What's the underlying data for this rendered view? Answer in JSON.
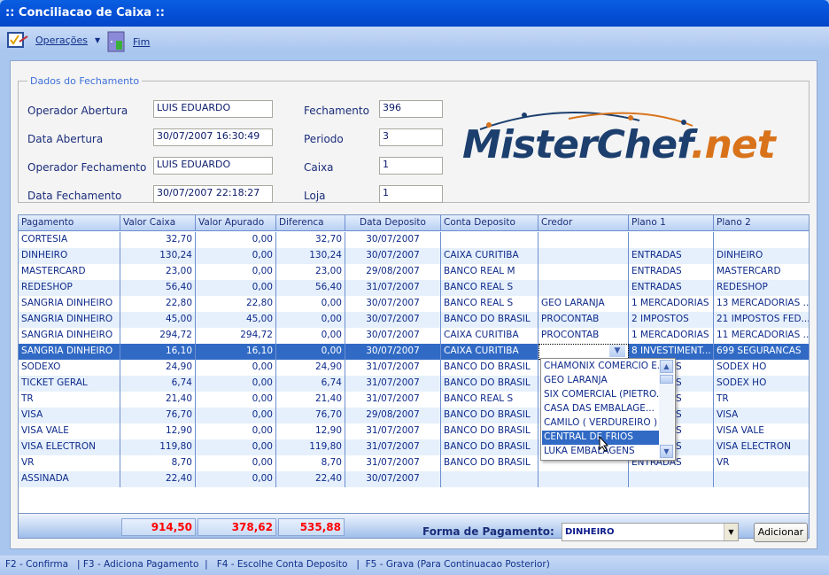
{
  "window": {
    "title": ":: Conciliacao de Caixa ::"
  },
  "toolbar": {
    "operacoes": "Operações",
    "fim": "Fim"
  },
  "fieldset": {
    "legend": "Dados do Fechamento",
    "operador_abertura_label": "Operador Abertura",
    "operador_abertura": "LUIS EDUARDO",
    "data_abertura_label": "Data Abertura",
    "data_abertura": "30/07/2007 16:30:49",
    "operador_fechamento_label": "Operador Fechamento",
    "operador_fechamento": "LUIS EDUARDO",
    "data_fechamento_label": "Data Fechamento",
    "data_fechamento": "30/07/2007 22:18:27",
    "fechamento_label": "Fechamento",
    "fechamento": "396",
    "periodo_label": "Periodo",
    "periodo": "3",
    "caixa_label": "Caixa",
    "caixa": "1",
    "loja_label": "Loja",
    "loja": "1"
  },
  "logo": {
    "text": "MisterChef",
    "suffix": ".net"
  },
  "grid": {
    "columns": [
      "Pagamento",
      "Valor Caixa",
      "Valor Apurado",
      "Diferenca",
      "Data Deposito",
      "Conta Deposito",
      "Credor",
      "Plano 1",
      "Plano 2"
    ],
    "rows": [
      [
        "CORTESIA",
        "32,70",
        "0,00",
        "32,70",
        "30/07/2007",
        "",
        "",
        "",
        ""
      ],
      [
        "DINHEIRO",
        "130,24",
        "0,00",
        "130,24",
        "30/07/2007",
        "CAIXA CURITIBA",
        "",
        "ENTRADAS",
        "DINHEIRO"
      ],
      [
        "MASTERCARD",
        "23,00",
        "0,00",
        "23,00",
        "29/08/2007",
        "BANCO REAL M",
        "",
        "ENTRADAS",
        "MASTERCARD"
      ],
      [
        "REDESHOP",
        "56,40",
        "0,00",
        "56,40",
        "31/07/2007",
        "BANCO REAL S",
        "",
        "ENTRADAS",
        "REDESHOP"
      ],
      [
        "SANGRIA DINHEIRO",
        "22,80",
        "22,80",
        "0,00",
        "30/07/2007",
        "BANCO REAL S",
        "GEO LARANJA",
        "1 MERCADORIAS",
        "13 MERCADORIAS ..."
      ],
      [
        "SANGRIA DINHEIRO",
        "45,00",
        "45,00",
        "0,00",
        "30/07/2007",
        "BANCO DO BRASIL",
        "PROCONTAB",
        "2 IMPOSTOS",
        "21 IMPOSTOS FED..."
      ],
      [
        "SANGRIA DINHEIRO",
        "294,72",
        "294,72",
        "0,00",
        "30/07/2007",
        "CAIXA CURITIBA",
        "PROCONTAB",
        "1 MERCADORIAS",
        "11 MERCADORIAS ..."
      ],
      [
        "SANGRIA DINHEIRO",
        "16,10",
        "16,10",
        "0,00",
        "30/07/2007",
        "CAIXA CURITIBA",
        "",
        "8 INVESTIMENT...",
        "699 SEGURANCAS"
      ],
      [
        "SODEXO",
        "24,90",
        "0,00",
        "24,90",
        "31/07/2007",
        "BANCO DO BRASIL",
        "",
        "ENTRADAS",
        "SODEX HO"
      ],
      [
        "TICKET GERAL",
        "6,74",
        "0,00",
        "6,74",
        "31/07/2007",
        "BANCO DO BRASIL",
        "",
        "ENTRADAS",
        "SODEX HO"
      ],
      [
        "TR",
        "21,40",
        "0,00",
        "21,40",
        "31/07/2007",
        "BANCO REAL S",
        "",
        "ENTRADAS",
        "TR"
      ],
      [
        "VISA",
        "76,70",
        "0,00",
        "76,70",
        "29/08/2007",
        "BANCO DO BRASIL",
        "",
        "ENTRADAS",
        "VISA"
      ],
      [
        "VISA  VALE",
        "12,90",
        "0,00",
        "12,90",
        "31/07/2007",
        "BANCO DO BRASIL",
        "",
        "ENTRADAS",
        "VISA VALE"
      ],
      [
        "VISA ELECTRON",
        "119,80",
        "0,00",
        "119,80",
        "31/07/2007",
        "BANCO DO BRASIL",
        "",
        "ENTRADAS",
        "VISA ELECTRON"
      ],
      [
        "VR",
        "8,70",
        "0,00",
        "8,70",
        "31/07/2007",
        "BANCO DO BRASIL",
        "",
        "ENTRADAS",
        "VR"
      ],
      [
        "ASSINADA",
        "22,40",
        "0,00",
        "22,40",
        "30/07/2007",
        "",
        "",
        "",
        ""
      ]
    ],
    "selected_row": 7,
    "totals": {
      "valor_caixa": "914,50",
      "valor_apurado": "378,62",
      "diferenca": "535,88"
    }
  },
  "credor_dropdown": {
    "items": [
      "CHAMONIX COMERCIO E...",
      "GEO LARANJA",
      "SIX COMERCIAL (PIETRO...",
      "CASA DAS  EMBALAGE...",
      "CAMILO  ( VERDUREIRO )",
      "CENTRAL DE FRIOS",
      "LUKA EMBALAGENS"
    ],
    "highlighted": 5
  },
  "forma_pagamento": {
    "label": "Forma de Pagamento:",
    "value": "DINHEIRO",
    "add_button": "Adicionar"
  },
  "status_bar": {
    "text": "F2 - Confirma   | F3 - Adiciona Pagamento  |   F4 - Escolhe Conta Deposito   |  F5 - Grava (Para Continuacao Posterior)"
  },
  "colors": {
    "title_bar": "#0550d8",
    "selection": "#316ac5",
    "totals": "#ff0000",
    "text": "#0d2a8a"
  }
}
